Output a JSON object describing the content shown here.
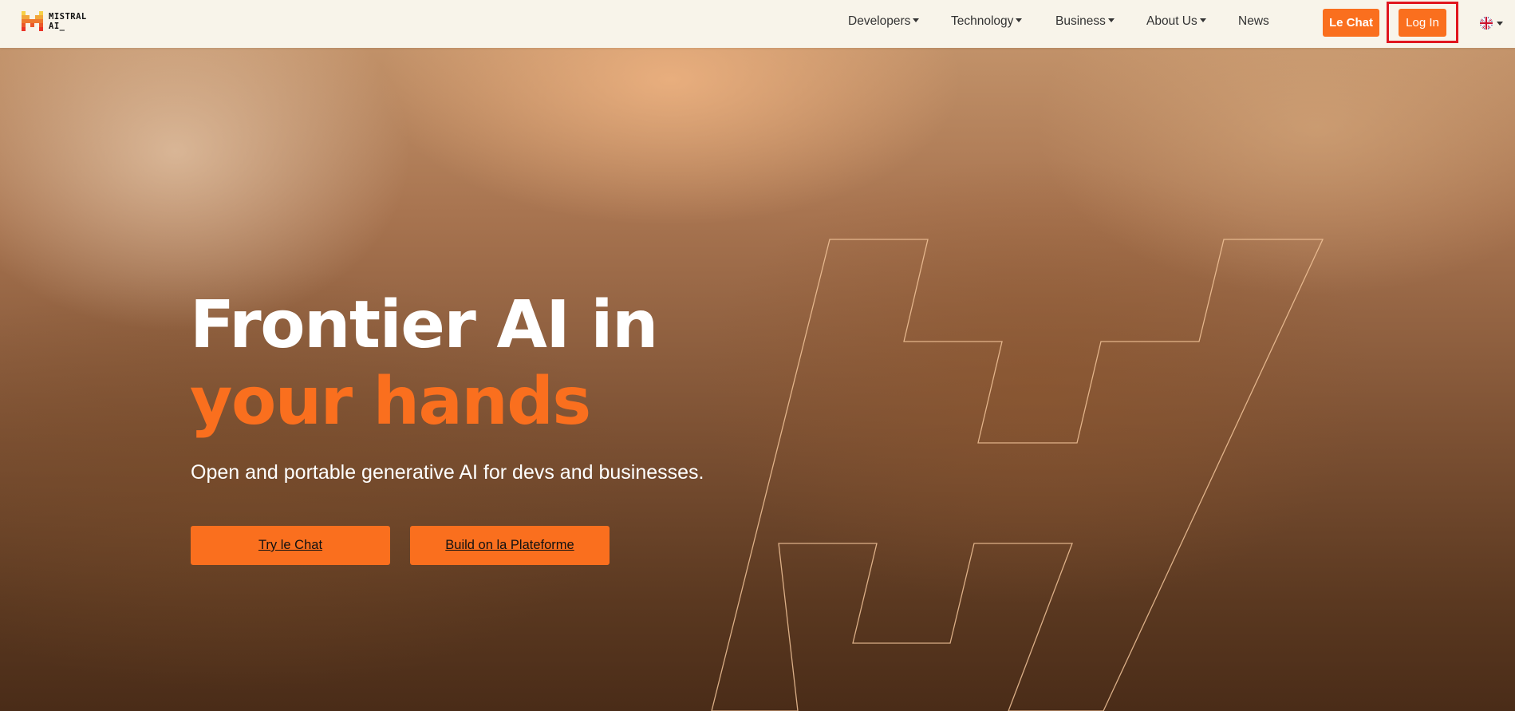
{
  "header": {
    "logo": {
      "line1": "MISTRAL",
      "line2": "AI_",
      "icon": "mistral-logo-icon"
    },
    "nav": [
      {
        "label": "Developers",
        "has_dropdown": true
      },
      {
        "label": "Technology",
        "has_dropdown": true
      },
      {
        "label": "Business",
        "has_dropdown": true
      },
      {
        "label": "About Us",
        "has_dropdown": true
      },
      {
        "label": "News",
        "has_dropdown": false
      }
    ],
    "le_chat_label": "Le Chat",
    "login_label": "Log In",
    "language": {
      "icon": "uk-flag-icon",
      "has_dropdown": true
    }
  },
  "hero": {
    "title_line1": "Frontier AI in",
    "title_line2": "your hands",
    "subtitle": "Open and portable generative AI for devs and businesses.",
    "cta_primary": "Try le Chat",
    "cta_secondary": "Build on la Plateforme"
  },
  "colors": {
    "accent": "#fa6f1e",
    "header_bg": "#f8f4ea",
    "highlight": "#e0161f",
    "outline": "#f2c49a"
  }
}
